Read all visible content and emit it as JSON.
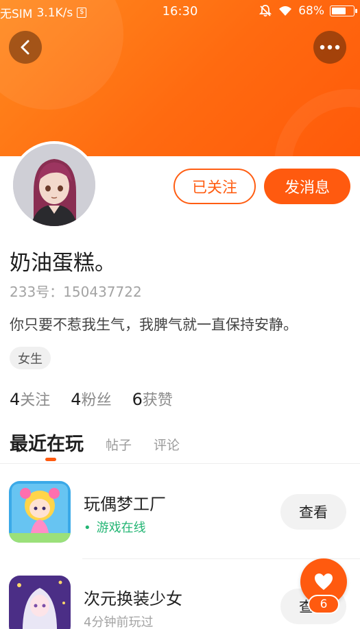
{
  "status_bar": {
    "carrier": "无SIM",
    "speed": "3.1K/s",
    "money_glyph": "$",
    "time": "16:30",
    "battery": "68%",
    "battery_level": 0.68,
    "icons": [
      "no-sim",
      "dollar-box-icon",
      "mute-bell-icon",
      "wifi-icon",
      "battery-icon"
    ]
  },
  "header": {
    "colors": {
      "accent": "#ff5a0f",
      "header_start": "#ff8a1e",
      "header_end": "#ff5a0a"
    }
  },
  "profile": {
    "actions": {
      "follow_label": "已关注",
      "message_label": "发消息"
    },
    "nickname": "奶油蛋糕。",
    "user_id": "233号：150437722",
    "bio": "你只要不惹我生气，我脾气就一直保持安静。",
    "gender_tag": "女生"
  },
  "stats": [
    {
      "num": "4",
      "label": "关注"
    },
    {
      "num": "4",
      "label": "粉丝"
    },
    {
      "num": "6",
      "label": "获赞"
    }
  ],
  "tabs": [
    {
      "label": "最近在玩",
      "active": true
    },
    {
      "label": "帖子",
      "active": false
    },
    {
      "label": "评论",
      "active": false
    }
  ],
  "games": [
    {
      "name": "玩偶梦工厂",
      "status": "游戏在线",
      "status_type": "online",
      "button": "查看"
    },
    {
      "name": "次元换装少女",
      "status": "4分钟前玩过",
      "status_type": "played",
      "button": "查看"
    }
  ],
  "like_fab": {
    "count": "6"
  }
}
